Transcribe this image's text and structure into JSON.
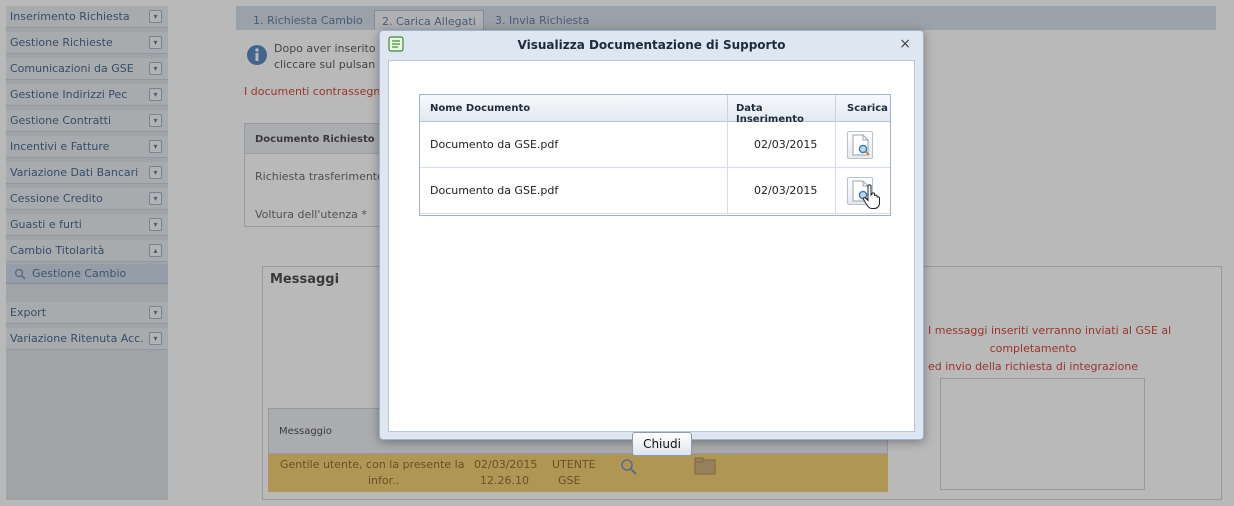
{
  "sidebar": {
    "items": [
      {
        "label": "Inserimento Richiesta",
        "toggle": "▾"
      },
      {
        "label": "Gestione Richieste",
        "toggle": "▾"
      },
      {
        "label": "Comunicazioni da GSE",
        "toggle": "▾"
      },
      {
        "label": "Gestione Indirizzi Pec",
        "toggle": "▾"
      },
      {
        "label": "Gestione Contratti",
        "toggle": "▾"
      },
      {
        "label": "Incentivi e Fatture",
        "toggle": "▾"
      },
      {
        "label": "Variazione Dati Bancari",
        "toggle": "▾"
      },
      {
        "label": "Cessione Credito",
        "toggle": "▾"
      },
      {
        "label": "Guasti e furti",
        "toggle": "▾"
      },
      {
        "label": "Cambio Titolarità",
        "toggle": "▴"
      },
      {
        "label": "Export",
        "toggle": "▾"
      },
      {
        "label": "Variazione Ritenuta Acc.",
        "toggle": "▾"
      }
    ],
    "subitem": {
      "label": "Gestione Cambio",
      "icon": "search-icon"
    }
  },
  "tabs": [
    {
      "label": "1. Richiesta Cambio"
    },
    {
      "label": "2. Carica Allegati"
    },
    {
      "label": "3. Invia Richiesta"
    }
  ],
  "info": {
    "line1": "Dopo aver inserito",
    "line2": "cliccare sul pulsan"
  },
  "warning_text": "I documenti contrassegn",
  "documents_panel": {
    "header": "Documento Richiesto",
    "rows": [
      "Richiesta trasferimento",
      "Voltura dell'utenza *"
    ]
  },
  "messages": {
    "title": "Messaggi",
    "column_header": "Messaggio",
    "notice_lines": [
      "I messaggi inseriti verranno inviati al GSE al",
      "completamento",
      "ed invio della richiesta di integrazione"
    ],
    "row": {
      "text_line1": "Gentile utente, con la presente la",
      "text_line2": "infor..",
      "date": "02/03/2015",
      "time": "12.26.10",
      "sender_line1": "UTENTE",
      "sender_line2": "GSE"
    }
  },
  "modal": {
    "title": "Visualizza Documentazione di Supporto",
    "close": "×",
    "columns": [
      "Nome Documento",
      "Data Inserimento",
      "Scarica"
    ],
    "rows": [
      {
        "name": "Documento da GSE.pdf",
        "date": "02/03/2015"
      },
      {
        "name": "Documento da GSE.pdf",
        "date": "02/03/2015"
      }
    ],
    "close_button": "Chiudi"
  },
  "colors": {
    "accent_warning": "#cc2b1d",
    "message_row": "#f1c75d",
    "nav_text": "#2c4f7e"
  }
}
